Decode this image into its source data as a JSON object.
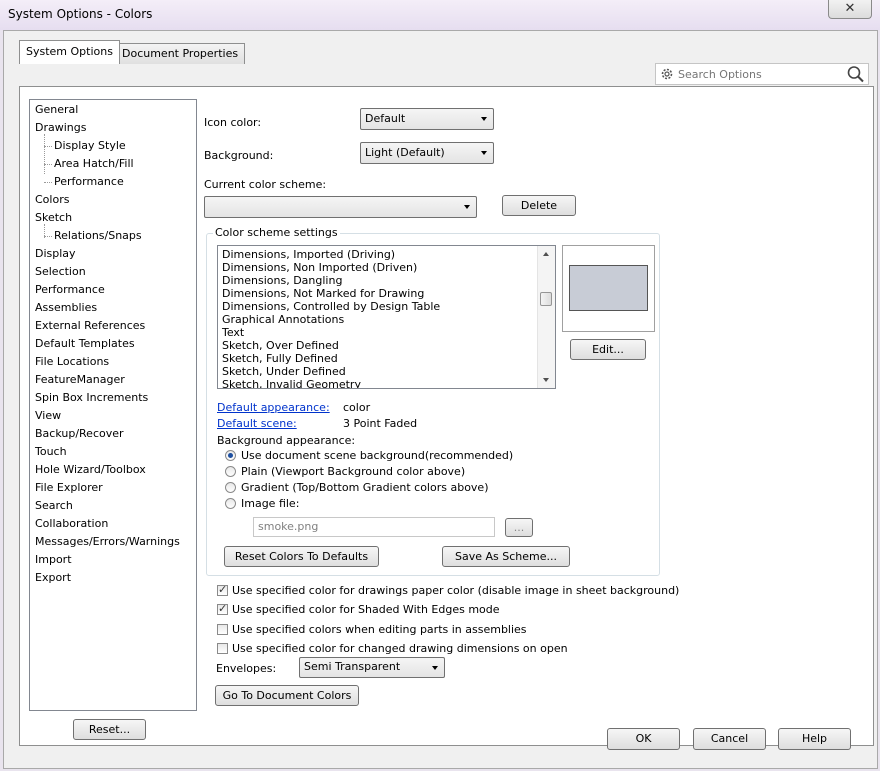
{
  "window": {
    "title": "System Options - Colors",
    "close_glyph": "✕"
  },
  "tabs": [
    {
      "label": "System Options"
    },
    {
      "label": "Document Properties"
    }
  ],
  "search": {
    "placeholder": "Search Options"
  },
  "tree": {
    "items": [
      {
        "label": "General",
        "level": 0
      },
      {
        "label": "Drawings",
        "level": 0
      },
      {
        "label": "Display Style",
        "level": 1
      },
      {
        "label": "Area Hatch/Fill",
        "level": 1
      },
      {
        "label": "Performance",
        "level": 1
      },
      {
        "label": "Colors",
        "level": 0
      },
      {
        "label": "Sketch",
        "level": 0
      },
      {
        "label": "Relations/Snaps",
        "level": 1
      },
      {
        "label": "Display",
        "level": 0
      },
      {
        "label": "Selection",
        "level": 0
      },
      {
        "label": "Performance",
        "level": 0
      },
      {
        "label": "Assemblies",
        "level": 0
      },
      {
        "label": "External References",
        "level": 0
      },
      {
        "label": "Default Templates",
        "level": 0
      },
      {
        "label": "File Locations",
        "level": 0
      },
      {
        "label": "FeatureManager",
        "level": 0
      },
      {
        "label": "Spin Box Increments",
        "level": 0
      },
      {
        "label": "View",
        "level": 0
      },
      {
        "label": "Backup/Recover",
        "level": 0
      },
      {
        "label": "Touch",
        "level": 0
      },
      {
        "label": "Hole Wizard/Toolbox",
        "level": 0
      },
      {
        "label": "File Explorer",
        "level": 0
      },
      {
        "label": "Search",
        "level": 0
      },
      {
        "label": "Collaboration",
        "level": 0
      },
      {
        "label": "Messages/Errors/Warnings",
        "level": 0
      },
      {
        "label": "Import",
        "level": 0
      },
      {
        "label": "Export",
        "level": 0
      }
    ],
    "reset_label": "Reset..."
  },
  "colors": {
    "icon_color_label": "Icon color:",
    "icon_color_value": "Default",
    "background_label": "Background:",
    "background_value": "Light (Default)",
    "scheme_label": "Current color scheme:",
    "scheme_value": "",
    "delete_label": "Delete",
    "settings_title": "Color scheme settings",
    "settings_list": [
      "Dimensions, Imported (Driving)",
      "Dimensions, Non Imported (Driven)",
      "Dimensions, Dangling",
      "Dimensions, Not Marked for Drawing",
      "Dimensions, Controlled by Design Table",
      "Graphical Annotations",
      "Text",
      "Sketch, Over Defined",
      "Sketch, Fully Defined",
      "Sketch, Under Defined",
      "Sketch, Invalid Geometry"
    ],
    "swatch_color": "#c8ccd6",
    "edit_label": "Edit...",
    "default_appearance_label": "Default appearance:",
    "default_appearance_value": "color",
    "default_scene_label": "Default scene:",
    "default_scene_value": "3 Point Faded",
    "bg_appearance_label": "Background appearance:",
    "radios": [
      {
        "label": "Use document scene background(recommended)",
        "checked": true
      },
      {
        "label": "Plain (Viewport Background color above)",
        "checked": false
      },
      {
        "label": "Gradient (Top/Bottom Gradient colors above)",
        "checked": false
      },
      {
        "label": "Image file:",
        "checked": false
      }
    ],
    "image_file_value": "smoke.png",
    "browse_label": "...",
    "reset_colors_label": "Reset Colors To Defaults",
    "save_scheme_label": "Save As Scheme...",
    "checkboxes": [
      {
        "label": "Use specified color for drawings paper color (disable image in sheet background)",
        "checked": true
      },
      {
        "label": "Use specified color for Shaded With Edges mode",
        "checked": true
      },
      {
        "label": "Use specified colors when editing parts in assemblies",
        "checked": false
      },
      {
        "label": "Use specified color for changed drawing dimensions on open",
        "checked": false
      }
    ],
    "envelopes_label": "Envelopes:",
    "envelopes_value": "Semi Transparent",
    "goto_doc_colors_label": "Go To Document Colors"
  },
  "footer": {
    "ok_label": "OK",
    "cancel_label": "Cancel",
    "help_label": "Help"
  }
}
